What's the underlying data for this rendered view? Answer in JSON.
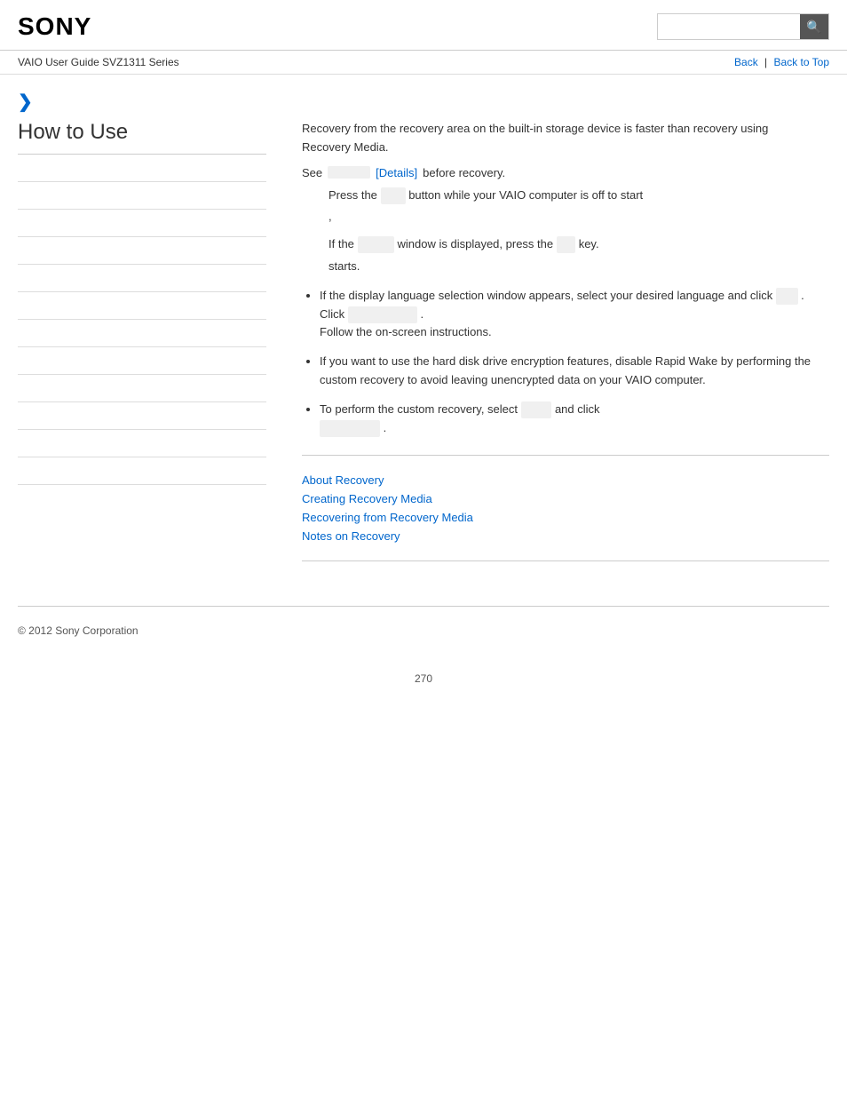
{
  "header": {
    "logo": "SONY",
    "search_placeholder": ""
  },
  "nav": {
    "guide_title": "VAIO User Guide SVZ1311 Series",
    "back_label": "Back",
    "back_to_top_label": "Back to Top",
    "separator": "|"
  },
  "breadcrumb": {
    "arrow": "❯"
  },
  "sidebar": {
    "title": "How to Use",
    "items": [
      {
        "label": ""
      },
      {
        "label": ""
      },
      {
        "label": ""
      },
      {
        "label": ""
      },
      {
        "label": ""
      },
      {
        "label": ""
      },
      {
        "label": ""
      },
      {
        "label": ""
      },
      {
        "label": ""
      },
      {
        "label": ""
      },
      {
        "label": ""
      },
      {
        "label": ""
      }
    ]
  },
  "content": {
    "intro_line1": "Recovery from the recovery area on the built-in storage device is faster than recovery using",
    "intro_line2": "Recovery Media.",
    "see_label": "See",
    "details_link": "[Details]",
    "before_recovery": "before recovery.",
    "press_the": "Press the",
    "press_btn_placeholder": "",
    "press_rest": "button while your VAIO computer is off to start",
    "if_the": "If the",
    "if_window_placeholder": "",
    "window_displayed": "window is displayed, press the",
    "key_placeholder": "",
    "key_label": "key.",
    "starts_label": "starts.",
    "bullet1": "If the display language selection window appears, select your desired language and click",
    "click_placeholder": "",
    "click_label": "Click",
    "click_action_placeholder": "",
    "follow_label": "Follow the on-screen instructions.",
    "bullet2": "If you want to use the hard disk drive encryption features, disable Rapid Wake by performing the custom recovery to avoid leaving unencrypted data on your VAIO computer.",
    "bullet3_prefix": "To perform the custom recovery, select",
    "bullet3_select_placeholder": "",
    "bullet3_and_click": "and click",
    "related_links": {
      "about_recovery": "About Recovery",
      "creating_recovery_media": "Creating Recovery Media",
      "recovering_from_recovery_media": "Recovering from Recovery Media",
      "notes_on_recovery": "Notes on Recovery"
    }
  },
  "footer": {
    "copyright": "© 2012 Sony Corporation"
  },
  "page_number": "270",
  "icons": {
    "search": "🔍"
  }
}
